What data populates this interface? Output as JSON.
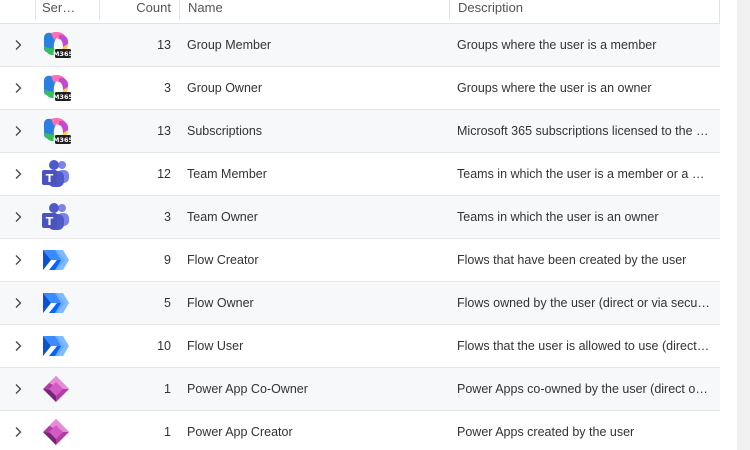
{
  "columns": {
    "service": "Ser…",
    "count": "Count",
    "name": "Name",
    "description": "Description"
  },
  "rows": [
    {
      "icon": "m365-icon",
      "count": "13",
      "name": "Group Member",
      "description": "Groups where the user is a member"
    },
    {
      "icon": "m365-icon",
      "count": "3",
      "name": "Group Owner",
      "description": "Groups where the user is an owner"
    },
    {
      "icon": "m365-icon",
      "count": "13",
      "name": "Subscriptions",
      "description": "Microsoft 365 subscriptions licensed to the u…"
    },
    {
      "icon": "teams-icon",
      "count": "12",
      "name": "Team Member",
      "description": "Teams in which the user is a member or a gu…"
    },
    {
      "icon": "teams-icon",
      "count": "3",
      "name": "Team Owner",
      "description": "Teams in which the user is an owner"
    },
    {
      "icon": "power-automate-icon",
      "count": "9",
      "name": "Flow Creator",
      "description": "Flows that have been created by the user"
    },
    {
      "icon": "power-automate-icon",
      "count": "5",
      "name": "Flow Owner",
      "description": "Flows owned by the user (direct or via securi…"
    },
    {
      "icon": "power-automate-icon",
      "count": "10",
      "name": "Flow User",
      "description": "Flows that the user is allowed to use (direct …"
    },
    {
      "icon": "power-apps-icon",
      "count": "1",
      "name": "Power App Co-Owner",
      "description": "Power Apps co-owned by the user (direct or …"
    },
    {
      "icon": "power-apps-icon",
      "count": "1",
      "name": "Power App Creator",
      "description": "Power Apps created by the user"
    }
  ]
}
